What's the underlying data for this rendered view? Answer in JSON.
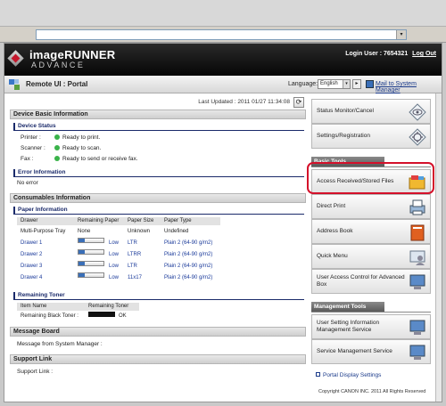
{
  "browser": {
    "address_value": "",
    "dropdown_glyph": "▾"
  },
  "header": {
    "brand_line1": "imageRUNNER",
    "brand_line2": "ADVANCE",
    "login_label": "Login User : 7654321",
    "logout_label": "Log Out"
  },
  "titlebar": {
    "title": "Remote UI : Portal",
    "language_label": "Language:",
    "language_value": "English",
    "mail_link": "Mail to System Manager"
  },
  "left": {
    "last_updated": "Last Updated : 2011 01/27 11:34:08",
    "refresh_glyph": "⟳",
    "device_basic_info": {
      "header": "Device Basic Information",
      "device_status_header": "Device Status",
      "statuses": [
        {
          "label": "Printer :",
          "value": "Ready to print."
        },
        {
          "label": "Scanner :",
          "value": "Ready to scan."
        },
        {
          "label": "Fax :",
          "value": "Ready to send or receive fax."
        }
      ],
      "error_header": "Error Information",
      "error_value": "No error"
    },
    "consumables": {
      "header": "Consumables Information",
      "paper_header": "Paper Information",
      "paper_columns": [
        "Drawer",
        "Remaining Paper",
        "Paper Size",
        "Paper Type"
      ],
      "paper_rows": [
        {
          "drawer": "Multi-Purpose Tray",
          "remaining": "None",
          "size": "Unknown",
          "type": "Undefined",
          "bar": false,
          "level_fraction": null
        },
        {
          "drawer": "Drawer 1",
          "remaining": "Low",
          "size": "LTR",
          "type": "Plain 2 (64-90 g/m2)",
          "bar": true,
          "level_fraction": 0.25
        },
        {
          "drawer": "Drawer 2",
          "remaining": "Low",
          "size": "LTRR",
          "type": "Plain 2 (64-90 g/m2)",
          "bar": true,
          "level_fraction": 0.25
        },
        {
          "drawer": "Drawer 3",
          "remaining": "Low",
          "size": "LTR",
          "type": "Plain 2 (64-90 g/m2)",
          "bar": true,
          "level_fraction": 0.25
        },
        {
          "drawer": "Drawer 4",
          "remaining": "Low",
          "size": "11x17",
          "type": "Plain 2 (64-90 g/m2)",
          "bar": true,
          "level_fraction": 0.25
        }
      ],
      "toner_header": "Remaining Toner",
      "toner_columns": [
        "Item Name",
        "Remaining Toner"
      ],
      "toner_row": {
        "name": "Remaining Black Toner :",
        "value": "OK",
        "level_fraction": 1.0
      }
    },
    "message_board": {
      "header": "Message Board",
      "line": "Message from System Manager :"
    },
    "support_link": {
      "header": "Support Link",
      "line": "Support Link :"
    }
  },
  "sidebar": {
    "top_buttons": [
      {
        "label": "Status Monitor/Cancel",
        "icon": "eye-icon"
      },
      {
        "label": "Settings/Registration",
        "icon": "gear-icon"
      }
    ],
    "basic_tools_header": "Basic Tools",
    "basic_tools": [
      {
        "label": "Access Received/Stored Files",
        "icon": "folder-icon"
      },
      {
        "label": "Direct Print",
        "icon": "printer-icon"
      },
      {
        "label": "Address Book",
        "icon": "book-icon"
      },
      {
        "label": "Quick Menu",
        "icon": "person-icon"
      },
      {
        "label": "User Access Control for Advanced Box",
        "icon": "monitor-icon"
      }
    ],
    "management_tools_header": "Management Tools",
    "management_tools": [
      {
        "label": "User Setting Information Management Service",
        "icon": "monitor-icon"
      },
      {
        "label": "Service Management Service",
        "icon": "monitor-icon"
      }
    ],
    "portal_display_settings": "Portal Display Settings",
    "copyright": "Copyright CANON INC. 2011 All Rights Reserved"
  },
  "colors": {
    "highlight": "#d4102a",
    "status_ok": "#3ab34a",
    "link": "#1a3a8a"
  }
}
